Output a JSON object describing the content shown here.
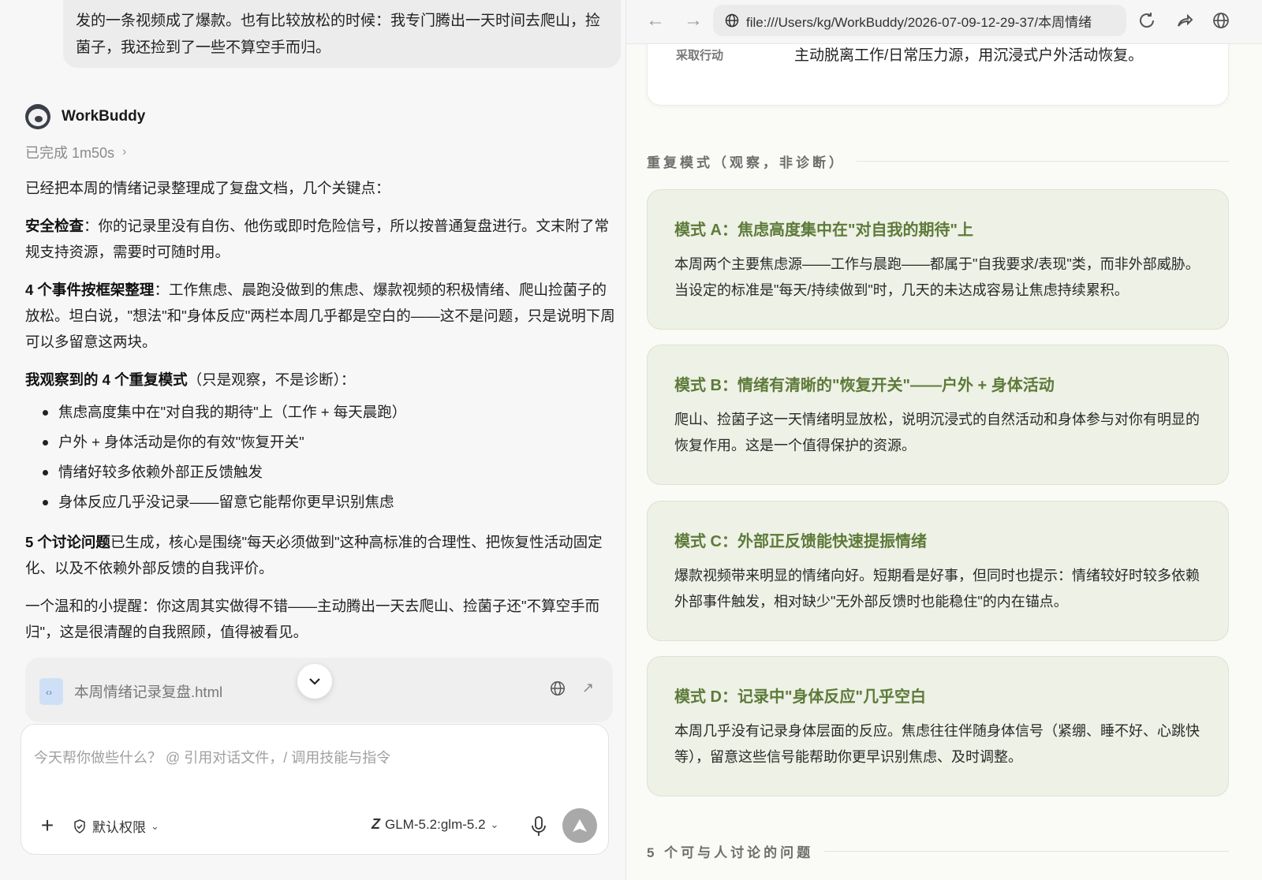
{
  "chat": {
    "user_message": "发的一条视频成了爆款。也有比较放松的时候：我专门腾出一天时间去爬山，捡菌子，我还捡到了一些不算空手而归。",
    "bot_name": "WorkBuddy",
    "status": "已完成 1m50s",
    "intro": "已经把本周的情绪记录整理成了复盘文档，几个关键点：",
    "safety_label": "安全检查",
    "safety_text": "：你的记录里没有自伤、他伤或即时危险信号，所以按普通复盘进行。文末附了常规支持资源，需要时可随时用。",
    "events_label": "4 个事件按框架整理",
    "events_text": "：工作焦虑、晨跑没做到的焦虑、爆款视频的积极情绪、爬山捡菌子的放松。坦白说，\"想法\"和\"身体反应\"两栏本周几乎都是空白的——这不是问题，只是说明下周可以多留意这两块。",
    "patterns_label": "我观察到的 4 个重复模式",
    "patterns_text": "（只是观察，不是诊断）：",
    "bullets": [
      "焦虑高度集中在\"对自我的期待\"上（工作 + 每天晨跑）",
      "户外 + 身体活动是你的有效\"恢复开关\"",
      "情绪好较多依赖外部正反馈触发",
      "身体反应几乎没记录——留意它能帮你更早识别焦虑"
    ],
    "questions_label": "5 个讨论问题",
    "questions_text": "已生成，核心是围绕\"每天必须做到\"这种高标准的合理性、把恢复性活动固定化、以及不依赖外部反馈的自我评价。",
    "reminder": "一个温和的小提醒：你这周其实做得不错——主动腾出一天去爬山、捡菌子还\"不算空手而归\"，这是很清醒的自我照顾，值得被看见。",
    "file_name": "本周情绪记录复盘.html"
  },
  "composer": {
    "placeholder": "今天帮你做些什么？ @ 引用对话文件，/ 调用技能与指令",
    "permission": "默认权限",
    "model": "GLM-5.2:glm-5.2"
  },
  "browser": {
    "url": "file:///Users/kg/WorkBuddy/2026-07-09-12-29-37/本周情绪",
    "top_card_label": "采取行动",
    "top_card_value": "主动脱离工作/日常压力源，用沉浸式户外活动恢复。",
    "patterns_section_title": "重复模式（观察，非诊断）",
    "patterns": [
      {
        "title": "模式 A：焦虑高度集中在\"对自我的期待\"上",
        "body": "本周两个主要焦虑源——工作与晨跑——都属于\"自我要求/表现\"类，而非外部威胁。当设定的标准是\"每天/持续做到\"时，几天的未达成容易让焦虑持续累积。"
      },
      {
        "title": "模式 B：情绪有清晰的\"恢复开关\"——户外 + 身体活动",
        "body": "爬山、捡菌子这一天情绪明显放松，说明沉浸式的自然活动和身体参与对你有明显的恢复作用。这是一个值得保护的资源。"
      },
      {
        "title": "模式 C：外部正反馈能快速提振情绪",
        "body": "爆款视频带来明显的情绪向好。短期看是好事，但同时也提示：情绪较好时较多依赖外部事件触发，相对缺少\"无外部反馈时也能稳住\"的内在锚点。"
      },
      {
        "title": "模式 D：记录中\"身体反应\"几乎空白",
        "body": "本周几乎没有记录身体层面的反应。焦虑往往伴随身体信号（紧绷、睡不好、心跳快等），留意这些信号能帮助你更早识别焦虑、及时调整。"
      }
    ],
    "questions_section_title": "5 个可与人讨论的问题"
  },
  "colors": {
    "accent_green": "#5d7a3a",
    "card_bg": "#eef1e5"
  }
}
